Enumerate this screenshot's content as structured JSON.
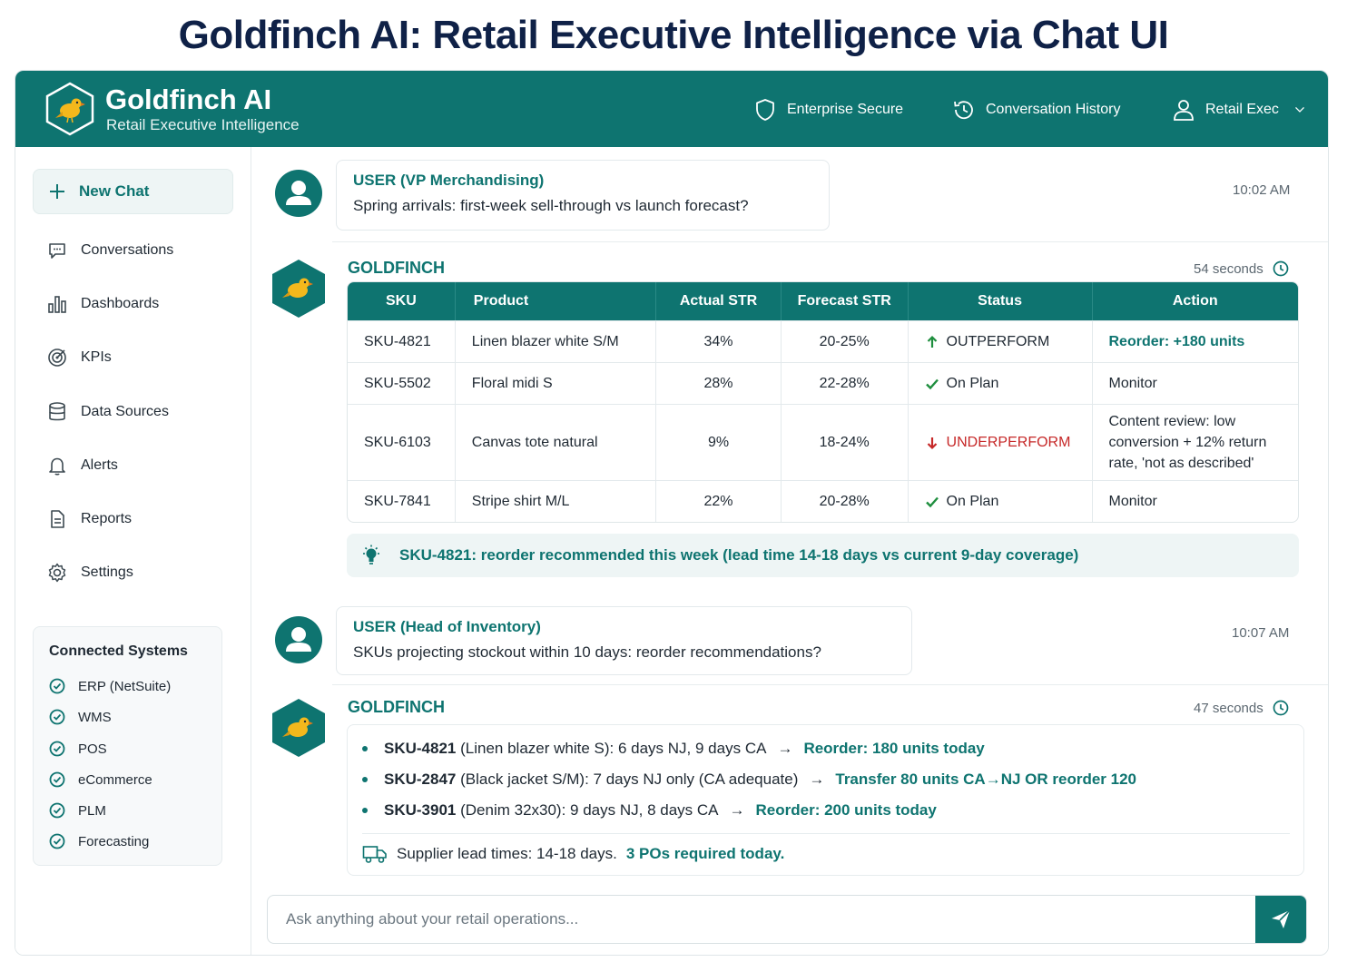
{
  "page_title": "Goldfinch AI: Retail Executive Intelligence via Chat UI",
  "header": {
    "brand_name": "Goldfinch AI",
    "brand_sub": "Retail Executive Intelligence",
    "enterprise": "Enterprise Secure",
    "history": "Conversation History",
    "user": "Retail Exec"
  },
  "sidebar": {
    "new_chat": "New Chat",
    "items": [
      {
        "label": "Conversations",
        "icon": "chat-icon"
      },
      {
        "label": "Dashboards",
        "icon": "bar-chart-icon"
      },
      {
        "label": "KPIs",
        "icon": "target-icon"
      },
      {
        "label": "Data Sources",
        "icon": "database-icon"
      },
      {
        "label": "Alerts",
        "icon": "bell-icon"
      },
      {
        "label": "Reports",
        "icon": "document-icon"
      },
      {
        "label": "Settings",
        "icon": "gear-icon"
      }
    ],
    "systems_title": "Connected Systems",
    "systems": [
      "ERP (NetSuite)",
      "WMS",
      "POS",
      "eCommerce",
      "PLM",
      "Forecasting"
    ]
  },
  "messages": {
    "m1": {
      "role": "USER (VP Merchandising)",
      "text": "Spring arrivals: first-week sell-through vs launch forecast?",
      "time": "10:02 AM"
    },
    "a1": {
      "name": "GOLDFINCH",
      "duration": "54 seconds",
      "columns": [
        "SKU",
        "Product",
        "Actual STR",
        "Forecast STR",
        "Status",
        "Action"
      ],
      "rows": [
        {
          "sku": "SKU-4821",
          "product": "Linen blazer white S/M",
          "actual": "34%",
          "forecast": "20-25%",
          "status": "OUTPERFORM",
          "action": "Reorder: +180 units"
        },
        {
          "sku": "SKU-5502",
          "product": "Floral midi S",
          "actual": "28%",
          "forecast": "22-28%",
          "status": "On Plan",
          "action": "Monitor"
        },
        {
          "sku": "SKU-6103",
          "product": "Canvas tote natural",
          "actual": "9%",
          "forecast": "18-24%",
          "status": "UNDERPERFORM",
          "action": "Content review: low conversion + 12% return rate, 'not as described'"
        },
        {
          "sku": "SKU-7841",
          "product": "Stripe shirt M/L",
          "actual": "22%",
          "forecast": "20-28%",
          "status": "On Plan",
          "action": "Monitor"
        }
      ],
      "insight": "SKU-4821: reorder recommended this week (lead time 14-18 days vs current 9-day coverage)"
    },
    "m2": {
      "role": "USER (Head of Inventory)",
      "text": "SKUs projecting stockout within 10 days: reorder recommendations?",
      "time": "10:07 AM"
    },
    "a2": {
      "name": "GOLDFINCH",
      "duration": "47 seconds",
      "items": [
        {
          "sku": "SKU-4821",
          "detail": "(Linen blazer white S): 6 days NJ, 9 days CA",
          "arrow": "→",
          "rec": "Reorder: 180 units today"
        },
        {
          "sku": "SKU-2847",
          "detail": "(Black jacket S/M): 7 days NJ only (CA adequate)",
          "arrow": "→",
          "rec": "Transfer 80 units CA→NJ OR reorder 120"
        },
        {
          "sku": "SKU-3901",
          "detail": "(Denim 32x30): 9 days NJ, 8 days CA",
          "arrow": "→",
          "rec": "Reorder: 200 units today"
        }
      ],
      "supplier_text": "Supplier lead times: 14-18 days.",
      "supplier_highlight": "3 POs required today."
    }
  },
  "composer": {
    "placeholder": "Ask anything about your retail operations..."
  },
  "colors": {
    "brand_teal": "#0e7470",
    "title_navy": "#0f2147",
    "underperform_red": "#c62828",
    "outperform_green": "#1e8e3e"
  }
}
